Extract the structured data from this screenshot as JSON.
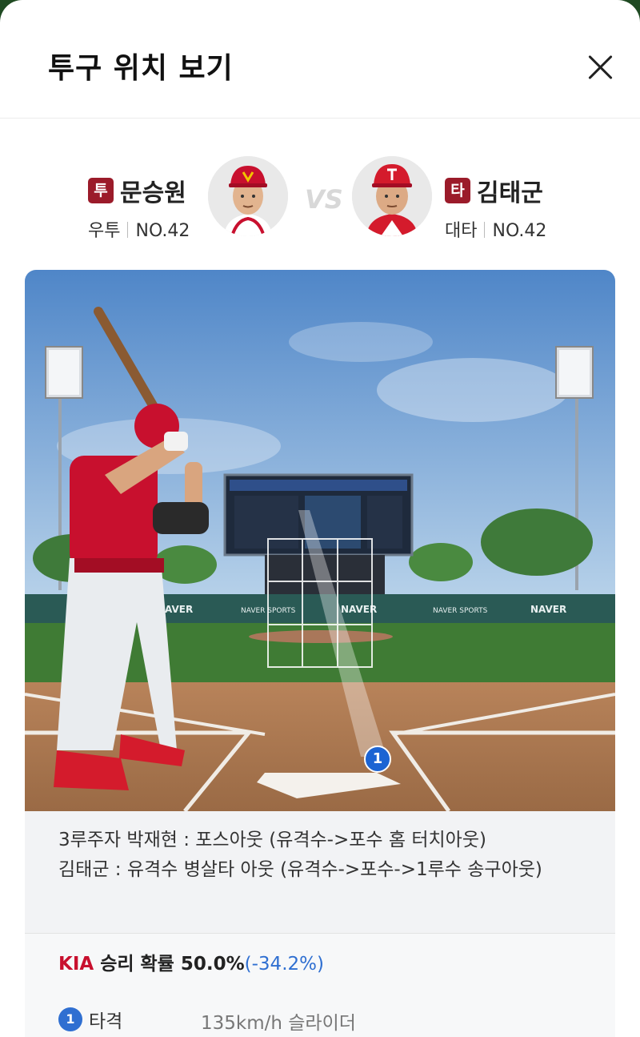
{
  "header": {
    "title": "투구 위치 보기"
  },
  "pitcher": {
    "badge": "투",
    "name": "문승원",
    "throws": "우투",
    "number": "NO.42"
  },
  "vs_label": "VS",
  "batter": {
    "badge": "타",
    "name": "김태군",
    "bats": "대타",
    "number": "NO.42"
  },
  "field": {
    "ad_boards": [
      "NAVER",
      "NAVER SPORTS",
      "NAVER",
      "NAVER SPORTS",
      "NAVER"
    ],
    "pitch_marker": "1"
  },
  "play_description": [
    "3루주자 박재현 : 포스아웃 (유격수->포수 홈 터치아웃)",
    "김태군 : 유격수 병살타 아웃 (유격수->포수->1루수 송구아웃)"
  ],
  "win_probability": {
    "team": "KIA",
    "label": " 승리 확률 50.0%",
    "change": "(-34.2%)"
  },
  "pitch_log": [
    {
      "number": "1",
      "result": "타격",
      "detail": "135km/h 슬라이더"
    }
  ],
  "colors": {
    "badge": "#9b1b2a",
    "team": "#c8102e",
    "accent": "#2f6fd1"
  }
}
